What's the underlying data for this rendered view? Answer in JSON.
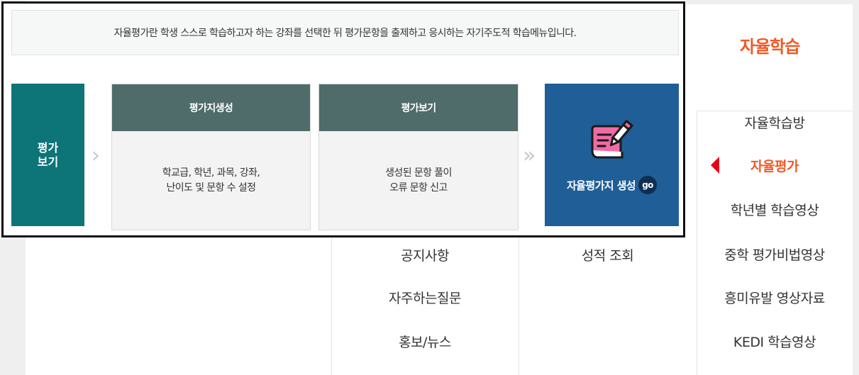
{
  "intro": {
    "text": "자율평가란 학생 스스로 학습하고자 하는 강좌를 선택한 뒤 평가문항을 출제하고 응시하는 자기주도적 학습메뉴입니다."
  },
  "steps": {
    "start_label": "평가\n보기",
    "separator_1": "›",
    "card_1": {
      "title": "평가지생성",
      "desc": "학교급, 학년, 과목, 강좌,\n난이도 및 문항 수 설정"
    },
    "card_2": {
      "title": "평가보기",
      "desc": "생성된 문항 풀이\n오류 문항 신고"
    },
    "separator_2": "»",
    "go_card": {
      "label": "자율평가지 생성",
      "badge": "go",
      "icon": "book-pencil-icon"
    }
  },
  "background_menu": {
    "col_1": [
      "공지사항",
      "자주하는질문",
      "홍보/뉴스"
    ],
    "col_2": [
      "성적 조회"
    ]
  },
  "side_nav": {
    "title": "자율학습",
    "items": [
      {
        "label": "자율학습방"
      },
      {
        "label": "자율평가"
      },
      {
        "label": "학년별 학습영상"
      },
      {
        "label": "중학 평가비법영상"
      },
      {
        "label": "흥미유발 영상자료"
      },
      {
        "label": "KEDI 학습영상"
      }
    ],
    "active_index": 1
  },
  "colors": {
    "accent_orange": "#f05a28",
    "marker_red": "#e8001c",
    "teal": "#0d7478",
    "card_header": "#4f6b6a",
    "go_blue": "#1f5e96",
    "go_badge": "#0f2f52",
    "book_pink": "#f26aa3"
  }
}
